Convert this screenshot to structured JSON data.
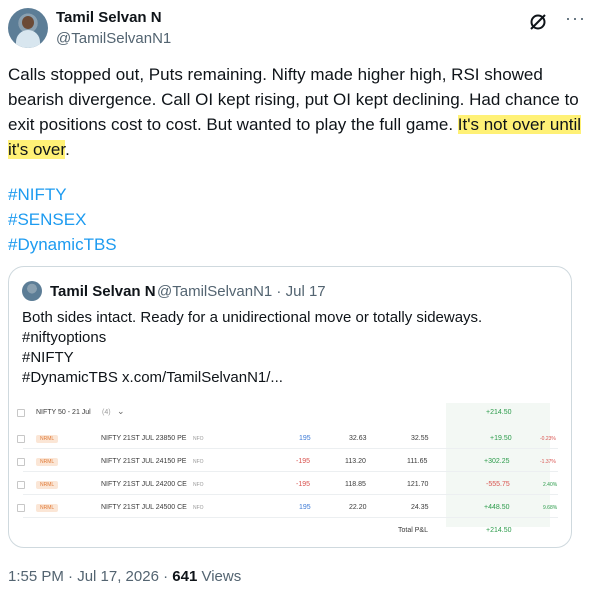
{
  "tweet": {
    "author_name": "Tamil Selvan N",
    "handle": "@TamilSelvanN1",
    "text_before": "Calls stopped out, Puts remaining. Nifty made higher high, RSI showed bearish divergence. Call OI kept rising, put OI kept declining. Had chance to exit positions cost to cost. But wanted to play the full game. ",
    "text_highlight": "It's not over until it's over",
    "text_after": ".",
    "hashtags": [
      "#NIFTY",
      "#SENSEX",
      "#DynamicTBS"
    ],
    "timestamp": "1:55 PM · Jul 17, 2026 · ",
    "views_count": "641",
    "views_label": " Views"
  },
  "quote": {
    "author_name": "Tamil Selvan N",
    "meta": "@TamilSelvanN1 · Jul 17",
    "lines": [
      "Both sides intact. Ready for a unidirectional move or totally sideways.",
      "#niftyoptions",
      "#NIFTY",
      "#DynamicTBS  x.com/TamilSelvanN1/..."
    ]
  },
  "positions": {
    "header": "NIFTY 50 - 21 Jul",
    "header_count": "(4)",
    "header_chevron": "⌄",
    "header_pnl": "+214.50",
    "rows": [
      {
        "badge": "NRML",
        "symbol": "NIFTY 21ST JUL 23850 PE",
        "exch": "NFO",
        "qty": "195",
        "avg": "32.63",
        "ltp": "32.55",
        "pnl": "+19.50",
        "chg": "-0.23%"
      },
      {
        "badge": "NRML",
        "symbol": "NIFTY 21ST JUL 24150 PE",
        "exch": "NFO",
        "qty": "-195",
        "avg": "113.20",
        "ltp": "111.65",
        "pnl": "+302.25",
        "chg": "-1.37%"
      },
      {
        "badge": "NRML",
        "symbol": "NIFTY 21ST JUL 24200 CE",
        "exch": "NFO",
        "qty": "-195",
        "avg": "118.85",
        "ltp": "121.70",
        "pnl": "-555.75",
        "chg": "2.40%"
      },
      {
        "badge": "NRML",
        "symbol": "NIFTY 21ST JUL 24500 CE",
        "exch": "NFO",
        "qty": "195",
        "avg": "22.20",
        "ltp": "24.35",
        "pnl": "+448.50",
        "chg": "9.68%"
      }
    ],
    "total_label": "Total P&L",
    "total_value": "+214.50"
  },
  "colors": {
    "link": "#1d9bf0",
    "highlight": "#fff176",
    "profit": "#2b9b4a",
    "loss": "#d9534f"
  }
}
